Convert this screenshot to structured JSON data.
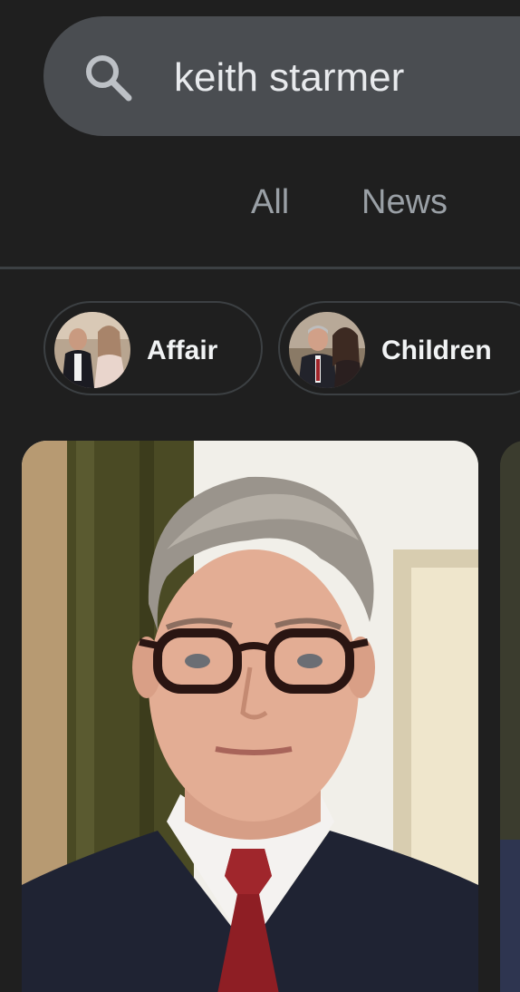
{
  "search": {
    "query": "keith starmer",
    "icon": "search-icon"
  },
  "tabs": [
    {
      "label": "All"
    },
    {
      "label": "News"
    }
  ],
  "chips": [
    {
      "label": "Affair",
      "icon": "affair-thumbnail"
    },
    {
      "label": "Children",
      "icon": "children-thumbnail"
    }
  ],
  "colors": {
    "background": "#1f1f1f",
    "search_bar": "#4a4d51",
    "tab_text": "#9aa0a6",
    "chip_border": "#3c4043",
    "chip_text": "#f1f3f4"
  }
}
